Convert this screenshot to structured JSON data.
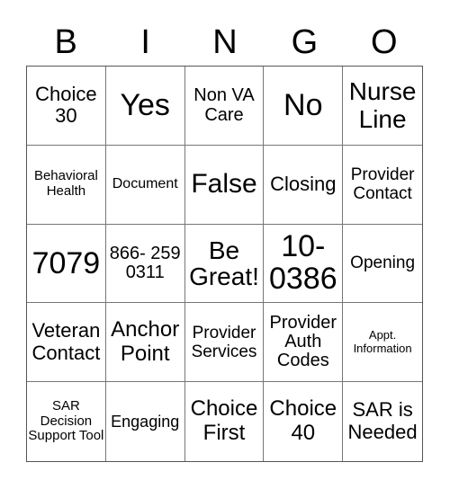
{
  "header": [
    "B",
    "I",
    "N",
    "G",
    "O"
  ],
  "cells": [
    "Choice 30",
    "Yes",
    "Non VA Care",
    "No",
    "Nurse Line",
    "Behavioral Health",
    "Document",
    "False",
    "Closing",
    "Provider Contact",
    "7079",
    "866- 259 0311",
    "Be Great!",
    "10- 0386",
    "Opening",
    "Veteran Contact",
    "Anchor Point",
    "Provider Services",
    "Provider Auth Codes",
    "Appt. Information",
    "SAR Decision Support Tool",
    "Engaging",
    "Choice First",
    "Choice 40",
    "SAR is Needed"
  ]
}
